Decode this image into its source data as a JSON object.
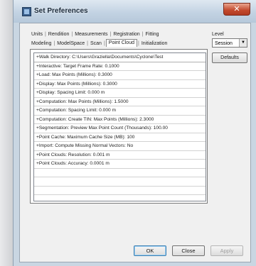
{
  "window": {
    "title": "Set Preferences",
    "close_glyph": "✕"
  },
  "tabs": {
    "row1": [
      "Units",
      "Rendition",
      "Measurements",
      "Registration",
      "Fitting"
    ],
    "row2": [
      "Modeling",
      "ModelSpace",
      "Scan",
      "Point Cloud",
      "Initialization"
    ],
    "active": "Point Cloud"
  },
  "level": {
    "label": "Level",
    "value": "Session"
  },
  "defaults_button": "Defaults",
  "preferences": [
    "+Walk Directory: C:\\Users\\Graziella\\Documents\\Cyclone\\Test",
    "+Interactive: Target Frame Rate: 0.1000",
    "+Load: Max Points (Millions): 0.3000",
    "+Display: Max Points (Millions): 0.3000",
    "+Display: Spacing Limit: 0.000 m",
    "+Computation: Max Points (Millions): 1.5000",
    "+Computation: Spacing Limit: 0.000 m",
    "+Computation: Create TIN: Max Points (Millions): 2.3000",
    "+Segmentation: Preview Max Point Count (Thousands): 100.00",
    "+Point Cache: Maximum Cache Size (MB): 100",
    "+Import: Compute Missing Normal Vectors: No",
    "+Point Clouds: Resolution: 0.001 m",
    "+Point Clouds: Accuracy: 0.0001 m",
    "",
    "",
    "",
    ""
  ],
  "buttons": {
    "ok": "OK",
    "close": "Close",
    "apply": "Apply"
  }
}
